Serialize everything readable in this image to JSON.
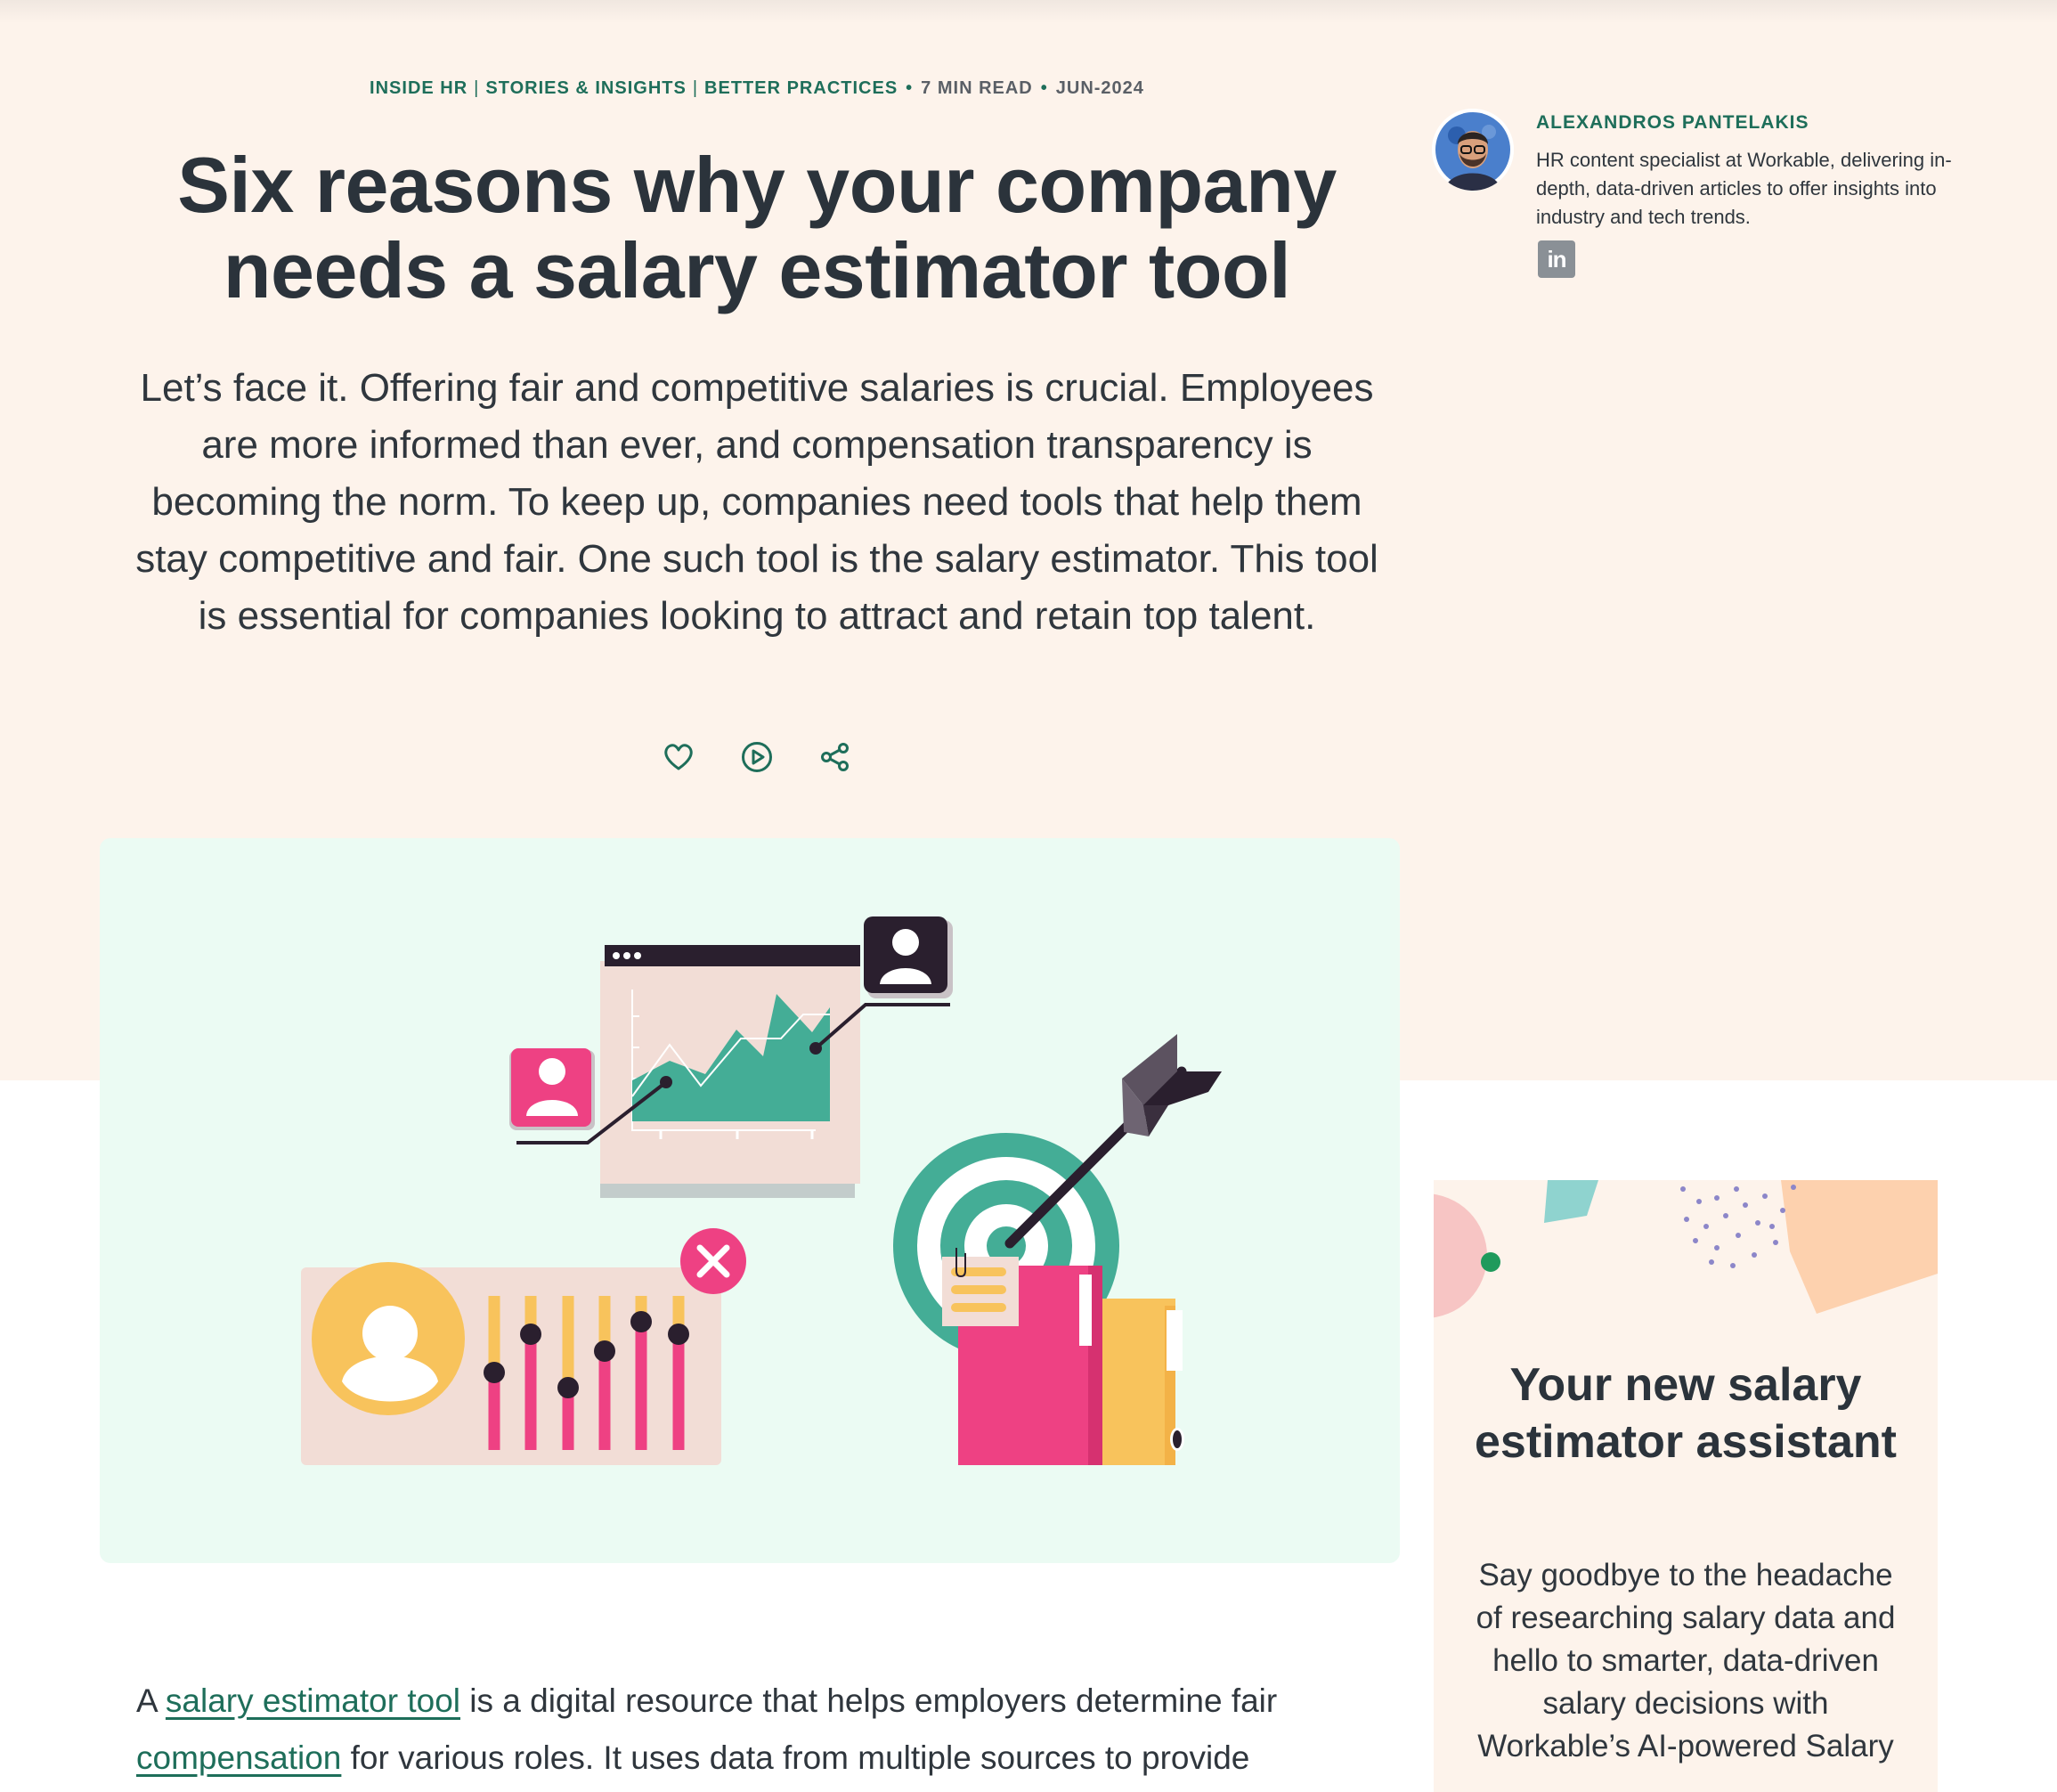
{
  "breadcrumb": {
    "categories": [
      "INSIDE HR",
      "STORIES & INSIGHTS",
      "BETTER PRACTICES"
    ],
    "read_time": "7 MIN READ",
    "date": "JUN-2024"
  },
  "article": {
    "title_line1": "Six reasons why your company",
    "title_line2": "needs a salary estimator tool",
    "intro": "Let’s face it. Offering fair and competitive salaries is crucial. Employees are more informed than ever, and compensation transparency is becoming the norm. To keep up, companies need tools that help them stay competitive and fair. One such tool is the salary estimator. This tool is essential for companies looking to attract and retain top talent.",
    "actions": [
      "like-icon",
      "play-icon",
      "share-icon"
    ],
    "body_prefix": "A ",
    "body_link1": "salary estimator tool",
    "body_middle": " is a digital resource that helps employers determine fair ",
    "body_link2": "compensation",
    "body_suffix": " for various roles. It uses data from multiple sources to provide"
  },
  "author": {
    "name": "ALEXANDROS PANTELAKIS",
    "bio": "HR content specialist at Workable, delivering in-depth, data-driven articles to offer insights into industry and tech trends.",
    "linkedin_label": "in"
  },
  "promo": {
    "title": "Your new salary estimator assistant",
    "text": "Say goodbye to the headache of researching salary data and hello to smarter, data-driven salary decisions with Workable’s AI-powered Salary"
  },
  "colors": {
    "hero_bg": "#fdf3eb",
    "accent_green": "#1e6e5a",
    "heading": "#2b333b",
    "illustration_bg": "#ebfbf3",
    "chart_green": "#44ad96",
    "pink": "#ee4183",
    "yellow": "#f8c35c"
  }
}
